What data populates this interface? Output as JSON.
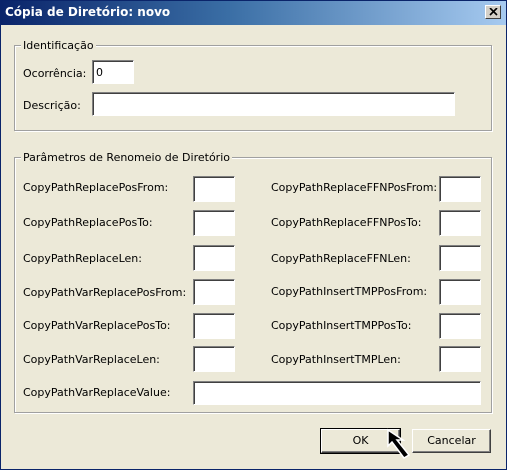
{
  "window": {
    "title": "Cópia de Diretório: novo"
  },
  "identificacao": {
    "legend": "Identificação",
    "ocorrencia": {
      "label": "Ocorrência:",
      "value": "0"
    },
    "descricao": {
      "label": "Descrição:",
      "value": ""
    }
  },
  "parametros": {
    "legend": "Parâmetros de Renomeio de Diretório",
    "left": [
      {
        "label": "CopyPathReplacePosFrom:",
        "value": ""
      },
      {
        "label": "CopyPathReplacePosTo:",
        "value": ""
      },
      {
        "label": "CopyPathReplaceLen:",
        "value": ""
      },
      {
        "label": "CopyPathVarReplacePosFrom:",
        "value": ""
      },
      {
        "label": "CopyPathVarReplacePosTo:",
        "value": ""
      },
      {
        "label": "CopyPathVarReplaceLen:",
        "value": ""
      }
    ],
    "right": [
      {
        "label": "CopyPathReplaceFFNPosFrom:",
        "value": ""
      },
      {
        "label": "CopyPathReplaceFFNPosTo:",
        "value": ""
      },
      {
        "label": "CopyPathReplaceFFNLen:",
        "value": ""
      },
      {
        "label": "CopyPathInsertTMPPosFrom:",
        "value": ""
      },
      {
        "label": "CopyPathInsertTMPPosTo:",
        "value": ""
      },
      {
        "label": "CopyPathInsertTMPLen:",
        "value": ""
      }
    ],
    "value": {
      "label": "CopyPathVarReplaceValue:",
      "value": ""
    }
  },
  "buttons": {
    "ok": "OK",
    "cancel": "Cancelar"
  }
}
